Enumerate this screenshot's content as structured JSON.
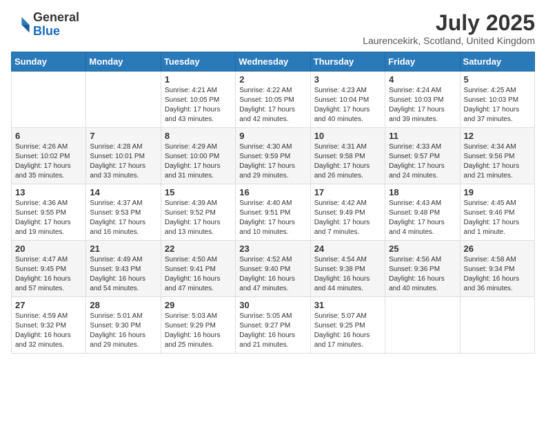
{
  "logo": {
    "general": "General",
    "blue": "Blue"
  },
  "title": "July 2025",
  "location": "Laurencekirk, Scotland, United Kingdom",
  "weekdays": [
    "Sunday",
    "Monday",
    "Tuesday",
    "Wednesday",
    "Thursday",
    "Friday",
    "Saturday"
  ],
  "weeks": [
    [
      {
        "day": "",
        "info": ""
      },
      {
        "day": "",
        "info": ""
      },
      {
        "day": "1",
        "info": "Sunrise: 4:21 AM\nSunset: 10:05 PM\nDaylight: 17 hours and 43 minutes."
      },
      {
        "day": "2",
        "info": "Sunrise: 4:22 AM\nSunset: 10:05 PM\nDaylight: 17 hours and 42 minutes."
      },
      {
        "day": "3",
        "info": "Sunrise: 4:23 AM\nSunset: 10:04 PM\nDaylight: 17 hours and 40 minutes."
      },
      {
        "day": "4",
        "info": "Sunrise: 4:24 AM\nSunset: 10:03 PM\nDaylight: 17 hours and 39 minutes."
      },
      {
        "day": "5",
        "info": "Sunrise: 4:25 AM\nSunset: 10:03 PM\nDaylight: 17 hours and 37 minutes."
      }
    ],
    [
      {
        "day": "6",
        "info": "Sunrise: 4:26 AM\nSunset: 10:02 PM\nDaylight: 17 hours and 35 minutes."
      },
      {
        "day": "7",
        "info": "Sunrise: 4:28 AM\nSunset: 10:01 PM\nDaylight: 17 hours and 33 minutes."
      },
      {
        "day": "8",
        "info": "Sunrise: 4:29 AM\nSunset: 10:00 PM\nDaylight: 17 hours and 31 minutes."
      },
      {
        "day": "9",
        "info": "Sunrise: 4:30 AM\nSunset: 9:59 PM\nDaylight: 17 hours and 29 minutes."
      },
      {
        "day": "10",
        "info": "Sunrise: 4:31 AM\nSunset: 9:58 PM\nDaylight: 17 hours and 26 minutes."
      },
      {
        "day": "11",
        "info": "Sunrise: 4:33 AM\nSunset: 9:57 PM\nDaylight: 17 hours and 24 minutes."
      },
      {
        "day": "12",
        "info": "Sunrise: 4:34 AM\nSunset: 9:56 PM\nDaylight: 17 hours and 21 minutes."
      }
    ],
    [
      {
        "day": "13",
        "info": "Sunrise: 4:36 AM\nSunset: 9:55 PM\nDaylight: 17 hours and 19 minutes."
      },
      {
        "day": "14",
        "info": "Sunrise: 4:37 AM\nSunset: 9:53 PM\nDaylight: 17 hours and 16 minutes."
      },
      {
        "day": "15",
        "info": "Sunrise: 4:39 AM\nSunset: 9:52 PM\nDaylight: 17 hours and 13 minutes."
      },
      {
        "day": "16",
        "info": "Sunrise: 4:40 AM\nSunset: 9:51 PM\nDaylight: 17 hours and 10 minutes."
      },
      {
        "day": "17",
        "info": "Sunrise: 4:42 AM\nSunset: 9:49 PM\nDaylight: 17 hours and 7 minutes."
      },
      {
        "day": "18",
        "info": "Sunrise: 4:43 AM\nSunset: 9:48 PM\nDaylight: 17 hours and 4 minutes."
      },
      {
        "day": "19",
        "info": "Sunrise: 4:45 AM\nSunset: 9:46 PM\nDaylight: 17 hours and 1 minute."
      }
    ],
    [
      {
        "day": "20",
        "info": "Sunrise: 4:47 AM\nSunset: 9:45 PM\nDaylight: 16 hours and 57 minutes."
      },
      {
        "day": "21",
        "info": "Sunrise: 4:49 AM\nSunset: 9:43 PM\nDaylight: 16 hours and 54 minutes."
      },
      {
        "day": "22",
        "info": "Sunrise: 4:50 AM\nSunset: 9:41 PM\nDaylight: 16 hours and 47 minutes."
      },
      {
        "day": "23",
        "info": "Sunrise: 4:52 AM\nSunset: 9:40 PM\nDaylight: 16 hours and 47 minutes."
      },
      {
        "day": "24",
        "info": "Sunrise: 4:54 AM\nSunset: 9:38 PM\nDaylight: 16 hours and 44 minutes."
      },
      {
        "day": "25",
        "info": "Sunrise: 4:56 AM\nSunset: 9:36 PM\nDaylight: 16 hours and 40 minutes."
      },
      {
        "day": "26",
        "info": "Sunrise: 4:58 AM\nSunset: 9:34 PM\nDaylight: 16 hours and 36 minutes."
      }
    ],
    [
      {
        "day": "27",
        "info": "Sunrise: 4:59 AM\nSunset: 9:32 PM\nDaylight: 16 hours and 32 minutes."
      },
      {
        "day": "28",
        "info": "Sunrise: 5:01 AM\nSunset: 9:30 PM\nDaylight: 16 hours and 29 minutes."
      },
      {
        "day": "29",
        "info": "Sunrise: 5:03 AM\nSunset: 9:29 PM\nDaylight: 16 hours and 25 minutes."
      },
      {
        "day": "30",
        "info": "Sunrise: 5:05 AM\nSunset: 9:27 PM\nDaylight: 16 hours and 21 minutes."
      },
      {
        "day": "31",
        "info": "Sunrise: 5:07 AM\nSunset: 9:25 PM\nDaylight: 16 hours and 17 minutes."
      },
      {
        "day": "",
        "info": ""
      },
      {
        "day": "",
        "info": ""
      }
    ]
  ]
}
